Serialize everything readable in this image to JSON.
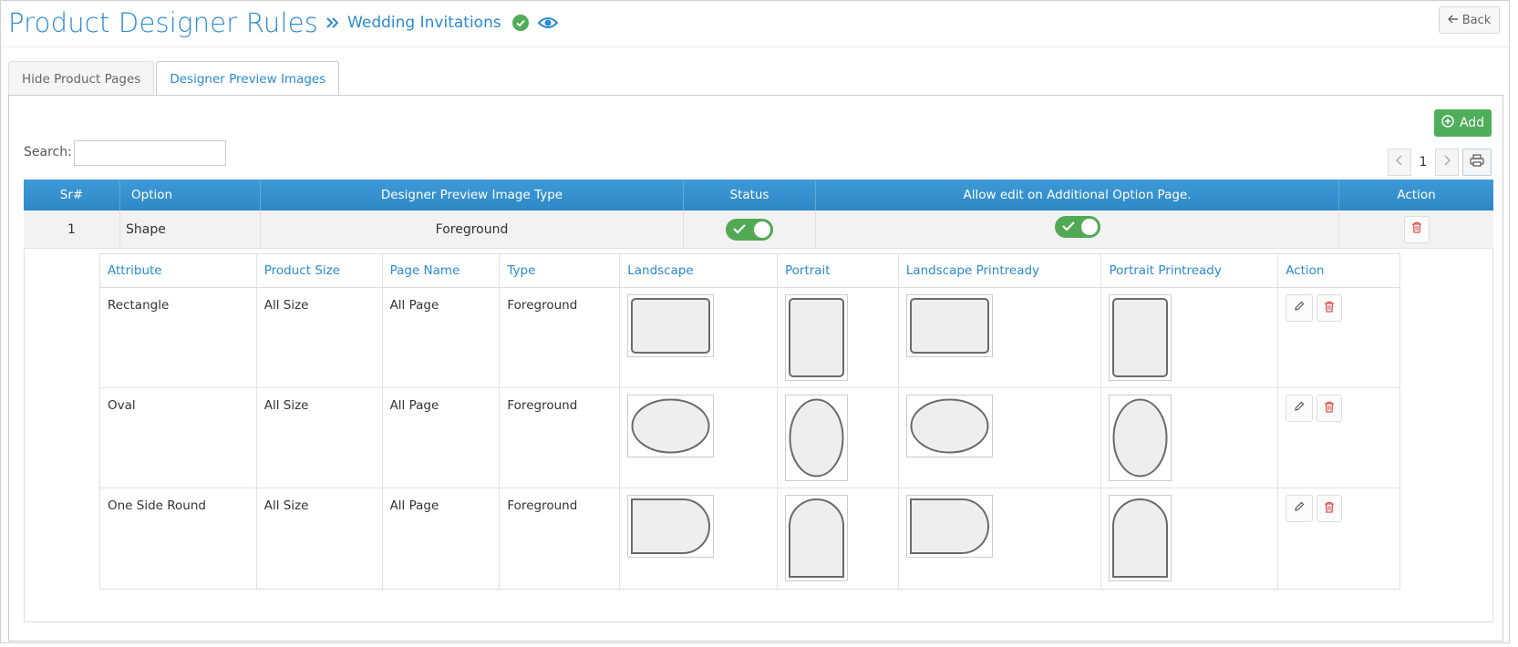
{
  "header": {
    "title": "Product Designer Rules",
    "breadcrumb": "Wedding Invitations",
    "back_label": "Back"
  },
  "tabs": [
    {
      "label": "Hide Product Pages",
      "active": false
    },
    {
      "label": "Designer Preview Images",
      "active": true
    }
  ],
  "toolbar": {
    "search_label": "Search:",
    "search_value": "",
    "add_label": "Add",
    "page_number": "1"
  },
  "table": {
    "headers": {
      "sr": "Sr#",
      "option": "Option",
      "type": "Designer Preview Image Type",
      "status": "Status",
      "allow_edit": "Allow edit on Additional Option Page.",
      "action": "Action"
    },
    "row": {
      "sr": "1",
      "option": "Shape",
      "type": "Foreground",
      "status_on": true,
      "allow_edit_on": true
    }
  },
  "subtable": {
    "headers": {
      "attribute": "Attribute",
      "product_size": "Product Size",
      "page_name": "Page Name",
      "type": "Type",
      "landscape": "Landscape",
      "portrait": "Portrait",
      "landscape_printready": "Landscape Printready",
      "portrait_printready": "Portrait Printready",
      "action": "Action"
    },
    "rows": [
      {
        "attribute": "Rectangle",
        "product_size": "All Size",
        "page_name": "All Page",
        "type": "Foreground",
        "shape": "rectangle"
      },
      {
        "attribute": "Oval",
        "product_size": "All Size",
        "page_name": "All Page",
        "type": "Foreground",
        "shape": "oval"
      },
      {
        "attribute": "One Side Round",
        "product_size": "All Size",
        "page_name": "All Page",
        "type": "Foreground",
        "shape": "one-side-round"
      }
    ]
  },
  "colors": {
    "accent": "#2b8ad1",
    "header_bar": "#3791cf",
    "success": "#4fae5a",
    "danger": "#d9534f"
  },
  "icons": [
    "double-chevron-right-icon",
    "check-circle-icon",
    "eye-icon",
    "arrow-left-icon",
    "plus-circle-icon",
    "chevron-left-icon",
    "chevron-right-icon",
    "printer-icon",
    "check-icon",
    "trash-icon",
    "pencil-icon"
  ]
}
